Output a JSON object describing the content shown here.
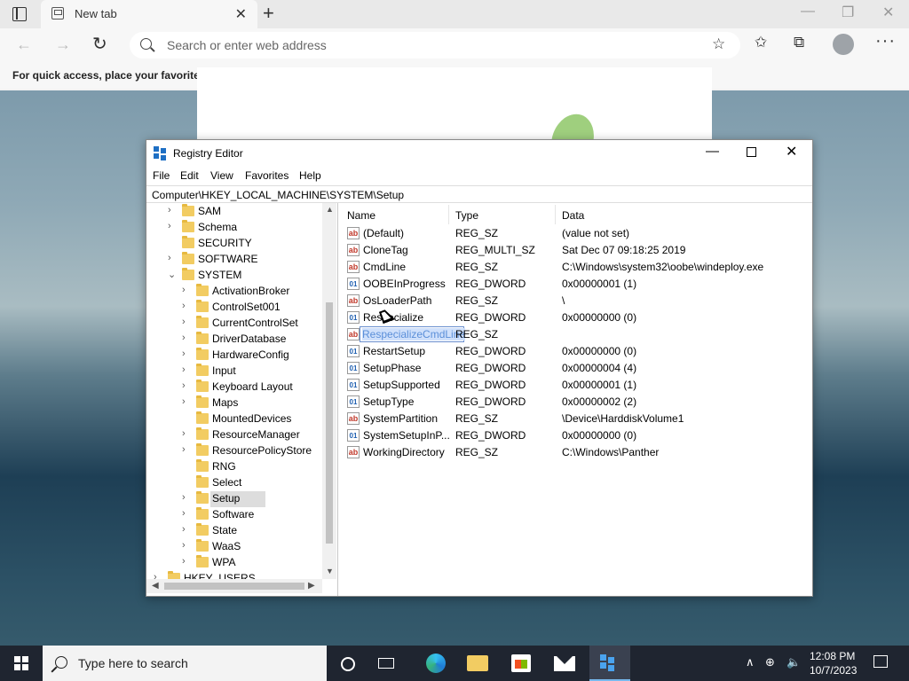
{
  "browser": {
    "tab_title": "New tab",
    "address_placeholder": "Search or enter web address",
    "favbar_text": "For quick access, place your favorites h"
  },
  "regedit": {
    "title": "Registry Editor",
    "menus": [
      "File",
      "Edit",
      "View",
      "Favorites",
      "Help"
    ],
    "path": "Computer\\HKEY_LOCAL_MACHINE\\SYSTEM\\Setup",
    "tree": [
      {
        "label": "SAM",
        "level": 1,
        "chevron": "›"
      },
      {
        "label": "Schema",
        "level": 1,
        "chevron": "›"
      },
      {
        "label": "SECURITY",
        "level": 1,
        "chevron": ""
      },
      {
        "label": "SOFTWARE",
        "level": 1,
        "chevron": "›"
      },
      {
        "label": "SYSTEM",
        "level": 1,
        "chevron": "⌄"
      },
      {
        "label": "ActivationBroker",
        "level": 2,
        "chevron": "›"
      },
      {
        "label": "ControlSet001",
        "level": 2,
        "chevron": "›"
      },
      {
        "label": "CurrentControlSet",
        "level": 2,
        "chevron": "›"
      },
      {
        "label": "DriverDatabase",
        "level": 2,
        "chevron": "›"
      },
      {
        "label": "HardwareConfig",
        "level": 2,
        "chevron": "›"
      },
      {
        "label": "Input",
        "level": 2,
        "chevron": "›"
      },
      {
        "label": "Keyboard Layout",
        "level": 2,
        "chevron": "›"
      },
      {
        "label": "Maps",
        "level": 2,
        "chevron": "›"
      },
      {
        "label": "MountedDevices",
        "level": 2,
        "chevron": ""
      },
      {
        "label": "ResourceManager",
        "level": 2,
        "chevron": "›"
      },
      {
        "label": "ResourcePolicyStore",
        "level": 2,
        "chevron": "›"
      },
      {
        "label": "RNG",
        "level": 2,
        "chevron": ""
      },
      {
        "label": "Select",
        "level": 2,
        "chevron": ""
      },
      {
        "label": "Setup",
        "level": 2,
        "chevron": "›",
        "selected": true
      },
      {
        "label": "Software",
        "level": 2,
        "chevron": "›"
      },
      {
        "label": "State",
        "level": 2,
        "chevron": "›"
      },
      {
        "label": "WaaS",
        "level": 2,
        "chevron": "›"
      },
      {
        "label": "WPA",
        "level": 2,
        "chevron": "›"
      },
      {
        "label": "HKEY_USERS",
        "level": 0,
        "chevron": "›"
      }
    ],
    "columns": {
      "name": "Name",
      "type": "Type",
      "data": "Data"
    },
    "values": [
      {
        "icon": "ab",
        "kind": "sz",
        "name": "(Default)",
        "type": "REG_SZ",
        "data": "(value not set)"
      },
      {
        "icon": "ab",
        "kind": "sz",
        "name": "CloneTag",
        "type": "REG_MULTI_SZ",
        "data": "Sat Dec 07 09:18:25 2019"
      },
      {
        "icon": "ab",
        "kind": "sz",
        "name": "CmdLine",
        "type": "REG_SZ",
        "data": "C:\\Windows\\system32\\oobe\\windeploy.exe"
      },
      {
        "icon": "01",
        "kind": "bin",
        "name": "OOBEInProgress",
        "type": "REG_DWORD",
        "data": "0x00000001 (1)"
      },
      {
        "icon": "ab",
        "kind": "sz",
        "name": "OsLoaderPath",
        "type": "REG_SZ",
        "data": "\\"
      },
      {
        "icon": "01",
        "kind": "bin",
        "name": "Respecialize",
        "type": "REG_DWORD",
        "data": "0x00000000 (0)"
      },
      {
        "icon": "ab",
        "kind": "sz",
        "name": "",
        "type": "REG_SZ",
        "data": "",
        "renaming": "RespecializeCmdLine"
      },
      {
        "icon": "01",
        "kind": "bin",
        "name": "RestartSetup",
        "type": "REG_DWORD",
        "data": "0x00000000 (0)"
      },
      {
        "icon": "01",
        "kind": "bin",
        "name": "SetupPhase",
        "type": "REG_DWORD",
        "data": "0x00000004 (4)"
      },
      {
        "icon": "01",
        "kind": "bin",
        "name": "SetupSupported",
        "type": "REG_DWORD",
        "data": "0x00000001 (1)"
      },
      {
        "icon": "01",
        "kind": "bin",
        "name": "SetupType",
        "type": "REG_DWORD",
        "data": "0x00000002 (2)"
      },
      {
        "icon": "ab",
        "kind": "sz",
        "name": "SystemPartition",
        "type": "REG_SZ",
        "data": "\\Device\\HarddiskVolume1"
      },
      {
        "icon": "01",
        "kind": "bin",
        "name": "SystemSetupInP...",
        "type": "REG_DWORD",
        "data": "0x00000000 (0)"
      },
      {
        "icon": "ab",
        "kind": "sz",
        "name": "WorkingDirectory",
        "type": "REG_SZ",
        "data": "C:\\Windows\\Panther"
      }
    ]
  },
  "taskbar": {
    "search_placeholder": "Type here to search",
    "time": "12:08 PM",
    "date": "10/7/2023"
  },
  "colors": {
    "accent": "#1e6fc4",
    "folder": "#f2cc62",
    "taskbar": "#1f2530"
  }
}
